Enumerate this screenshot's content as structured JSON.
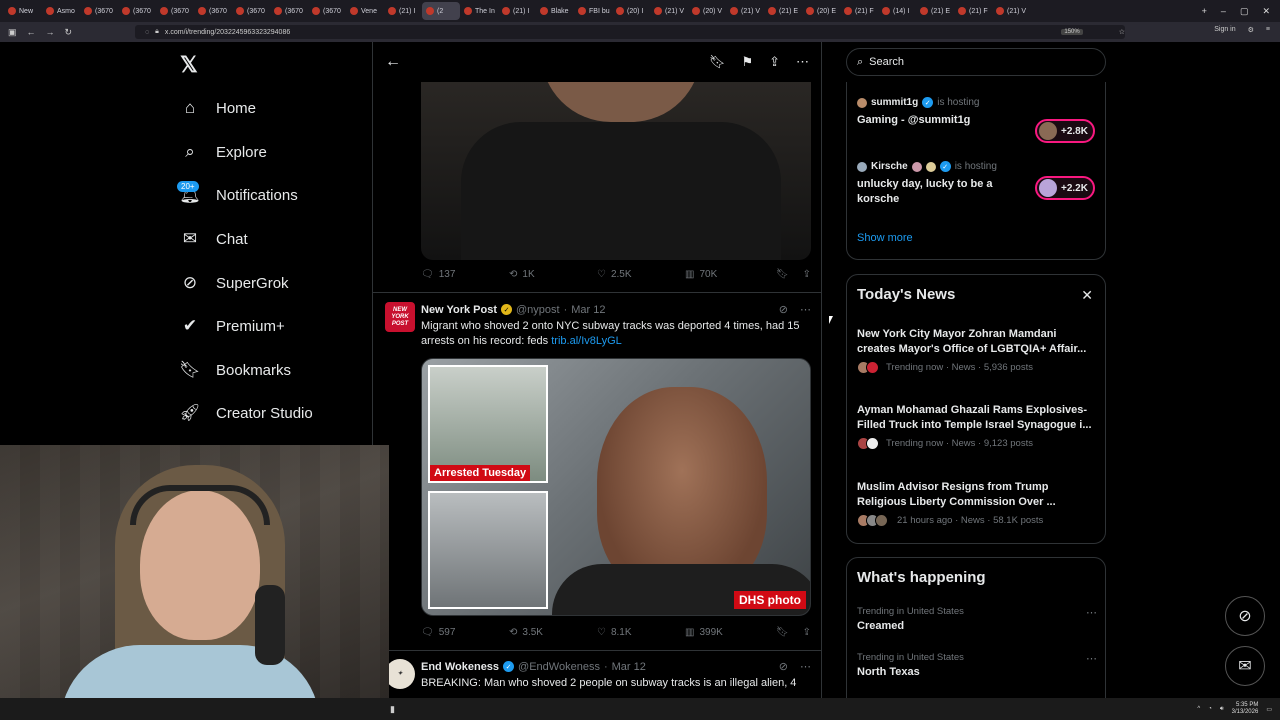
{
  "browser": {
    "tabs": [
      "New",
      "Asmo",
      "(3670",
      "(3670",
      "(3670",
      "(3670",
      "(3670",
      "(3670",
      "(3670",
      "Vene",
      "(21) I",
      "(2",
      "The In",
      "(21) I",
      "Blake",
      "FBI bu",
      "(20) I",
      "(21) V",
      "(20) V",
      "(21) V",
      "(21) E",
      "(20) E",
      "(21) F",
      "(14) I",
      "(21) E",
      "(21) F",
      "(21) V"
    ],
    "url": "x.com/i/trending/2032245963323294086",
    "zoom": "150%",
    "signin": "Sign in"
  },
  "sidebar": {
    "items": [
      {
        "label": "Home",
        "icon": "home-icon"
      },
      {
        "label": "Explore",
        "icon": "search-icon"
      },
      {
        "label": "Notifications",
        "icon": "bell-icon"
      },
      {
        "label": "Chat",
        "icon": "mail-icon"
      },
      {
        "label": "SuperGrok",
        "icon": "grok-icon"
      },
      {
        "label": "Premium+",
        "icon": "premium-icon"
      },
      {
        "label": "Bookmarks",
        "icon": "bookmark-icon"
      },
      {
        "label": "Creator Studio",
        "icon": "rocket-icon"
      }
    ],
    "notifications_badge": "20+"
  },
  "post1_stats": {
    "replies": "137",
    "reposts": "1K",
    "likes": "2.5K",
    "views": "70K"
  },
  "post2": {
    "name": "New York Post",
    "handle": "@nypost",
    "date": "Mar 12",
    "text": "Migrant who shoved 2 onto NYC subway tracks was deported 4 times, had 15 arrests on his record: feds ",
    "link": "trib.al/Iv8LyGL",
    "avatar_text": "NEW YORK POST",
    "label_arrested": "Arrested Tuesday",
    "label_dhs": "DHS photo",
    "stats": {
      "replies": "597",
      "reposts": "3.5K",
      "likes": "8.1K",
      "views": "399K"
    }
  },
  "post3": {
    "name": "End Wokeness",
    "handle": "@EndWokeness",
    "date": "Mar 12",
    "text": "BREAKING: Man who shoved 2 people on subway tracks is an illegal alien, 4"
  },
  "right": {
    "search_placeholder": "Search",
    "hosts": [
      {
        "user": "summit1g",
        "status": "is hosting",
        "title": "Gaming - @summit1g",
        "count": "+2.8K"
      },
      {
        "user": "Kirsche",
        "status": "is hosting",
        "title": "unlucky day, lucky to be a korsche",
        "count": "+2.2K"
      }
    ],
    "show_more": "Show more",
    "news_title": "Today's News",
    "news": [
      {
        "headline": "New York City Mayor Zohran Mamdani creates Mayor's Office of LGBTQIA+ Affair...",
        "meta": "Trending now · News · 5,936 posts"
      },
      {
        "headline": "Ayman Mohamad Ghazali Rams Explosives-Filled Truck into Temple Israel Synagogue i...",
        "meta": "Trending now · News · 9,123 posts"
      },
      {
        "headline": "Muslim Advisor Resigns from Trump Religious Liberty Commission Over ...",
        "meta": "21 hours ago · News · 58.1K posts"
      }
    ],
    "happening_title": "What's happening",
    "trends": [
      {
        "context": "Trending in United States",
        "topic": "Creamed"
      },
      {
        "context": "Trending in United States",
        "topic": "North Texas"
      }
    ]
  },
  "taskbar": {
    "time": "5:35 PM",
    "date": "3/13/2026"
  }
}
